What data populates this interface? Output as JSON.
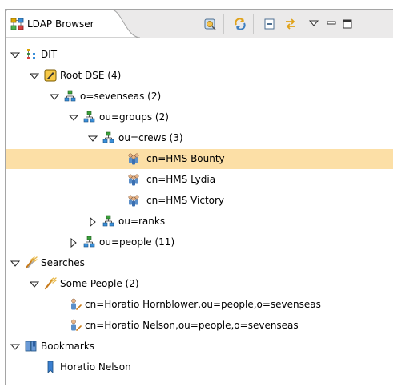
{
  "view": {
    "title": "LDAP Browser",
    "toolbar": [
      {
        "name": "link-with-editor-icon"
      },
      {
        "name": "refresh-icon"
      },
      {
        "name": "collapse-all-icon"
      },
      {
        "name": "link-icon"
      },
      {
        "name": "view-menu-icon"
      },
      {
        "name": "minimize-icon"
      },
      {
        "name": "maximize-icon"
      }
    ]
  },
  "tree": {
    "dit": {
      "label": "DIT"
    },
    "root_dse": {
      "label": "Root DSE (4)"
    },
    "sevenseas": {
      "label": "o=sevenseas (2)"
    },
    "groups": {
      "label": "ou=groups (2)"
    },
    "crews": {
      "label": "ou=crews (3)"
    },
    "bounty": {
      "label": "cn=HMS Bounty",
      "selected": true
    },
    "lydia": {
      "label": "cn=HMS Lydia"
    },
    "victory": {
      "label": "cn=HMS Victory"
    },
    "ranks": {
      "label": "ou=ranks"
    },
    "people": {
      "label": "ou=people (11)"
    },
    "searches": {
      "label": "Searches"
    },
    "some_people": {
      "label": "Some People (2)"
    },
    "hornblower": {
      "label": "cn=Horatio Hornblower,ou=people,o=sevenseas"
    },
    "nelson_result": {
      "label": "cn=Horatio Nelson,ou=people,o=sevenseas"
    },
    "bookmarks": {
      "label": "Bookmarks"
    },
    "nelson_bookmark": {
      "label": "Horatio Nelson"
    }
  },
  "colors": {
    "selection": "#fcdfa6",
    "tab_background": "#ebeaea",
    "border": "#a5a5a5"
  }
}
